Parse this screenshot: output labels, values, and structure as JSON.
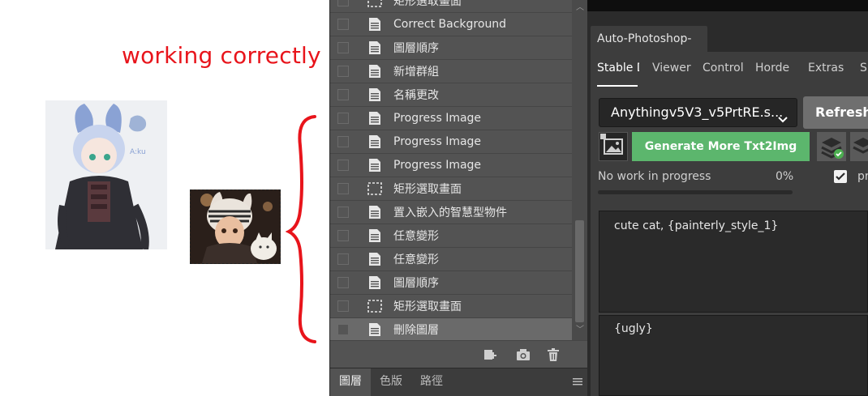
{
  "annotation": {
    "text": "working correctly",
    "color": "#e8141b"
  },
  "history": {
    "items": [
      {
        "label": "矩形選取畫面",
        "icon": "marquee-icon"
      },
      {
        "label": "Correct Background",
        "icon": "document-icon"
      },
      {
        "label": "圖層順序",
        "icon": "document-icon"
      },
      {
        "label": "新增群組",
        "icon": "document-icon"
      },
      {
        "label": "名稱更改",
        "icon": "document-icon"
      },
      {
        "label": "Progress Image",
        "icon": "document-icon"
      },
      {
        "label": "Progress Image",
        "icon": "document-icon"
      },
      {
        "label": "Progress Image",
        "icon": "document-icon"
      },
      {
        "label": "矩形選取畫面",
        "icon": "marquee-icon"
      },
      {
        "label": "置入嵌入的智慧型物件",
        "icon": "document-icon"
      },
      {
        "label": "任意變形",
        "icon": "document-icon"
      },
      {
        "label": "任意變形",
        "icon": "document-icon"
      },
      {
        "label": "圖層順序",
        "icon": "document-icon"
      },
      {
        "label": "矩形選取畫面",
        "icon": "marquee-icon"
      },
      {
        "label": "刪除圖層",
        "icon": "document-icon",
        "selected": true
      }
    ],
    "toolbar_icons": [
      "new-document-from-state-icon",
      "snapshot-camera-icon",
      "trash-icon"
    ],
    "tabs": [
      "圖層",
      "色版",
      "路徑"
    ],
    "active_tab": "圖層"
  },
  "plugin": {
    "title": "Auto-Photoshop-SD",
    "tabs": [
      "Stable D",
      "Viewer",
      "ControlN",
      "Horde",
      "Extras",
      "S"
    ],
    "active_tab": "Stable D",
    "model": "Anythingv5V3_v5PrtRE.s...",
    "refresh_label": "Refresh",
    "generate_label": "Generate More Txt2Img",
    "progress_text": "No work in progress",
    "progress_pct": "0%",
    "progress_value": 0,
    "extra_checkbox_label": "pr",
    "extra_checkbox_checked": true,
    "positive_prompt": "cute cat, {painterly_style_1}",
    "negative_prompt": "{ugly}",
    "accent_color": "#5cb66d"
  }
}
